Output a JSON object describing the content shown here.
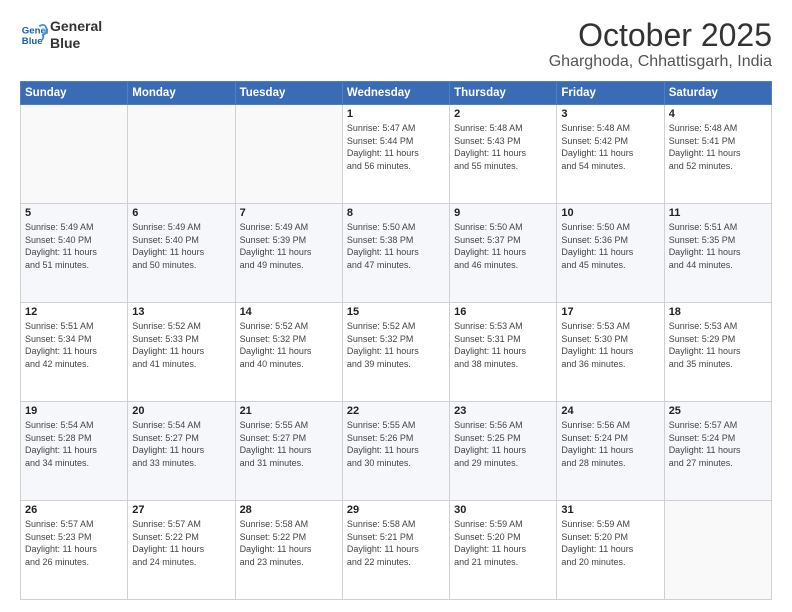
{
  "logo": {
    "line1": "General",
    "line2": "Blue"
  },
  "header": {
    "month": "October 2025",
    "location": "Gharghoda, Chhattisgarh, India"
  },
  "weekdays": [
    "Sunday",
    "Monday",
    "Tuesday",
    "Wednesday",
    "Thursday",
    "Friday",
    "Saturday"
  ],
  "weeks": [
    [
      {
        "day": "",
        "info": ""
      },
      {
        "day": "",
        "info": ""
      },
      {
        "day": "",
        "info": ""
      },
      {
        "day": "1",
        "info": "Sunrise: 5:47 AM\nSunset: 5:44 PM\nDaylight: 11 hours\nand 56 minutes."
      },
      {
        "day": "2",
        "info": "Sunrise: 5:48 AM\nSunset: 5:43 PM\nDaylight: 11 hours\nand 55 minutes."
      },
      {
        "day": "3",
        "info": "Sunrise: 5:48 AM\nSunset: 5:42 PM\nDaylight: 11 hours\nand 54 minutes."
      },
      {
        "day": "4",
        "info": "Sunrise: 5:48 AM\nSunset: 5:41 PM\nDaylight: 11 hours\nand 52 minutes."
      }
    ],
    [
      {
        "day": "5",
        "info": "Sunrise: 5:49 AM\nSunset: 5:40 PM\nDaylight: 11 hours\nand 51 minutes."
      },
      {
        "day": "6",
        "info": "Sunrise: 5:49 AM\nSunset: 5:40 PM\nDaylight: 11 hours\nand 50 minutes."
      },
      {
        "day": "7",
        "info": "Sunrise: 5:49 AM\nSunset: 5:39 PM\nDaylight: 11 hours\nand 49 minutes."
      },
      {
        "day": "8",
        "info": "Sunrise: 5:50 AM\nSunset: 5:38 PM\nDaylight: 11 hours\nand 47 minutes."
      },
      {
        "day": "9",
        "info": "Sunrise: 5:50 AM\nSunset: 5:37 PM\nDaylight: 11 hours\nand 46 minutes."
      },
      {
        "day": "10",
        "info": "Sunrise: 5:50 AM\nSunset: 5:36 PM\nDaylight: 11 hours\nand 45 minutes."
      },
      {
        "day": "11",
        "info": "Sunrise: 5:51 AM\nSunset: 5:35 PM\nDaylight: 11 hours\nand 44 minutes."
      }
    ],
    [
      {
        "day": "12",
        "info": "Sunrise: 5:51 AM\nSunset: 5:34 PM\nDaylight: 11 hours\nand 42 minutes."
      },
      {
        "day": "13",
        "info": "Sunrise: 5:52 AM\nSunset: 5:33 PM\nDaylight: 11 hours\nand 41 minutes."
      },
      {
        "day": "14",
        "info": "Sunrise: 5:52 AM\nSunset: 5:32 PM\nDaylight: 11 hours\nand 40 minutes."
      },
      {
        "day": "15",
        "info": "Sunrise: 5:52 AM\nSunset: 5:32 PM\nDaylight: 11 hours\nand 39 minutes."
      },
      {
        "day": "16",
        "info": "Sunrise: 5:53 AM\nSunset: 5:31 PM\nDaylight: 11 hours\nand 38 minutes."
      },
      {
        "day": "17",
        "info": "Sunrise: 5:53 AM\nSunset: 5:30 PM\nDaylight: 11 hours\nand 36 minutes."
      },
      {
        "day": "18",
        "info": "Sunrise: 5:53 AM\nSunset: 5:29 PM\nDaylight: 11 hours\nand 35 minutes."
      }
    ],
    [
      {
        "day": "19",
        "info": "Sunrise: 5:54 AM\nSunset: 5:28 PM\nDaylight: 11 hours\nand 34 minutes."
      },
      {
        "day": "20",
        "info": "Sunrise: 5:54 AM\nSunset: 5:27 PM\nDaylight: 11 hours\nand 33 minutes."
      },
      {
        "day": "21",
        "info": "Sunrise: 5:55 AM\nSunset: 5:27 PM\nDaylight: 11 hours\nand 31 minutes."
      },
      {
        "day": "22",
        "info": "Sunrise: 5:55 AM\nSunset: 5:26 PM\nDaylight: 11 hours\nand 30 minutes."
      },
      {
        "day": "23",
        "info": "Sunrise: 5:56 AM\nSunset: 5:25 PM\nDaylight: 11 hours\nand 29 minutes."
      },
      {
        "day": "24",
        "info": "Sunrise: 5:56 AM\nSunset: 5:24 PM\nDaylight: 11 hours\nand 28 minutes."
      },
      {
        "day": "25",
        "info": "Sunrise: 5:57 AM\nSunset: 5:24 PM\nDaylight: 11 hours\nand 27 minutes."
      }
    ],
    [
      {
        "day": "26",
        "info": "Sunrise: 5:57 AM\nSunset: 5:23 PM\nDaylight: 11 hours\nand 26 minutes."
      },
      {
        "day": "27",
        "info": "Sunrise: 5:57 AM\nSunset: 5:22 PM\nDaylight: 11 hours\nand 24 minutes."
      },
      {
        "day": "28",
        "info": "Sunrise: 5:58 AM\nSunset: 5:22 PM\nDaylight: 11 hours\nand 23 minutes."
      },
      {
        "day": "29",
        "info": "Sunrise: 5:58 AM\nSunset: 5:21 PM\nDaylight: 11 hours\nand 22 minutes."
      },
      {
        "day": "30",
        "info": "Sunrise: 5:59 AM\nSunset: 5:20 PM\nDaylight: 11 hours\nand 21 minutes."
      },
      {
        "day": "31",
        "info": "Sunrise: 5:59 AM\nSunset: 5:20 PM\nDaylight: 11 hours\nand 20 minutes."
      },
      {
        "day": "",
        "info": ""
      }
    ]
  ]
}
